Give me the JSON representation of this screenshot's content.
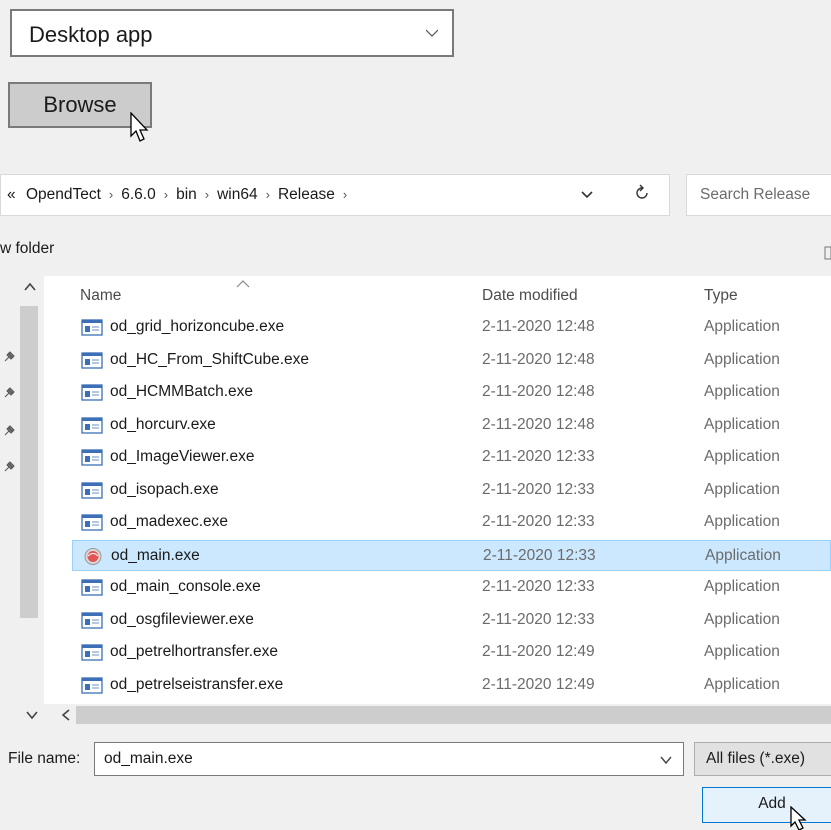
{
  "top": {
    "app_type_value": "Desktop app",
    "browse_label": "Browse"
  },
  "dialog": {
    "breadcrumb": [
      "«",
      "OpendTect",
      "6.6.0",
      "bin",
      "win64",
      "Release"
    ],
    "search_placeholder": "Search Release",
    "new_folder_label": "w folder",
    "columns": {
      "name": "Name",
      "date": "Date modified",
      "type": "Type"
    },
    "files": [
      {
        "name": "od_grid_horizoncube.exe",
        "date": "2-11-2020 12:48",
        "type": "Application"
      },
      {
        "name": "od_HC_From_ShiftCube.exe",
        "date": "2-11-2020 12:48",
        "type": "Application"
      },
      {
        "name": "od_HCMMBatch.exe",
        "date": "2-11-2020 12:48",
        "type": "Application"
      },
      {
        "name": "od_horcurv.exe",
        "date": "2-11-2020 12:48",
        "type": "Application"
      },
      {
        "name": "od_ImageViewer.exe",
        "date": "2-11-2020 12:33",
        "type": "Application"
      },
      {
        "name": "od_isopach.exe",
        "date": "2-11-2020 12:33",
        "type": "Application"
      },
      {
        "name": "od_madexec.exe",
        "date": "2-11-2020 12:33",
        "type": "Application"
      },
      {
        "name": "od_main.exe",
        "date": "2-11-2020 12:33",
        "type": "Application",
        "selected": true,
        "icon": "opendtect-app-icon"
      },
      {
        "name": "od_main_console.exe",
        "date": "2-11-2020 12:33",
        "type": "Application"
      },
      {
        "name": "od_osgfileviewer.exe",
        "date": "2-11-2020 12:33",
        "type": "Application"
      },
      {
        "name": "od_petrelhortransfer.exe",
        "date": "2-11-2020 12:49",
        "type": "Application"
      },
      {
        "name": "od_petrelseistransfer.exe",
        "date": "2-11-2020 12:49",
        "type": "Application"
      }
    ],
    "file_name_label": "File name:",
    "file_name_value": "od_main.exe",
    "filter_value": "All files (*.exe)",
    "add_label": "Add"
  },
  "colors": {
    "selection": "#cce8ff",
    "accent": "#0078d7"
  }
}
